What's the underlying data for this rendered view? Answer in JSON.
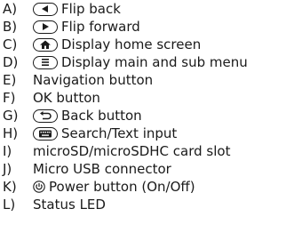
{
  "items": [
    {
      "letter": "A)",
      "icon": "flip-back-icon",
      "text": "Flip back"
    },
    {
      "letter": "B)",
      "icon": "flip-forward-icon",
      "text": "Flip forward"
    },
    {
      "letter": "C)",
      "icon": "home-icon",
      "text": "Display home screen"
    },
    {
      "letter": "D)",
      "icon": "menu-icon",
      "text": "Display main and sub menu"
    },
    {
      "letter": "E)",
      "icon": "",
      "text": "Navigation button"
    },
    {
      "letter": "F)",
      "icon": "",
      "text": "OK button"
    },
    {
      "letter": "G)",
      "icon": "back-arrow-icon",
      "text": "Back button"
    },
    {
      "letter": "H)",
      "icon": "keyboard-icon",
      "text": "Search/Text input"
    },
    {
      "letter": "I)",
      "icon": "",
      "text": "microSD/microSDHC card slot"
    },
    {
      "letter": "J)",
      "icon": "",
      "text": "Micro USB connector"
    },
    {
      "letter": "K)",
      "icon": "power-icon",
      "text": "Power button (On/Off)"
    },
    {
      "letter": "L)",
      "icon": "",
      "text": "Status LED"
    }
  ]
}
